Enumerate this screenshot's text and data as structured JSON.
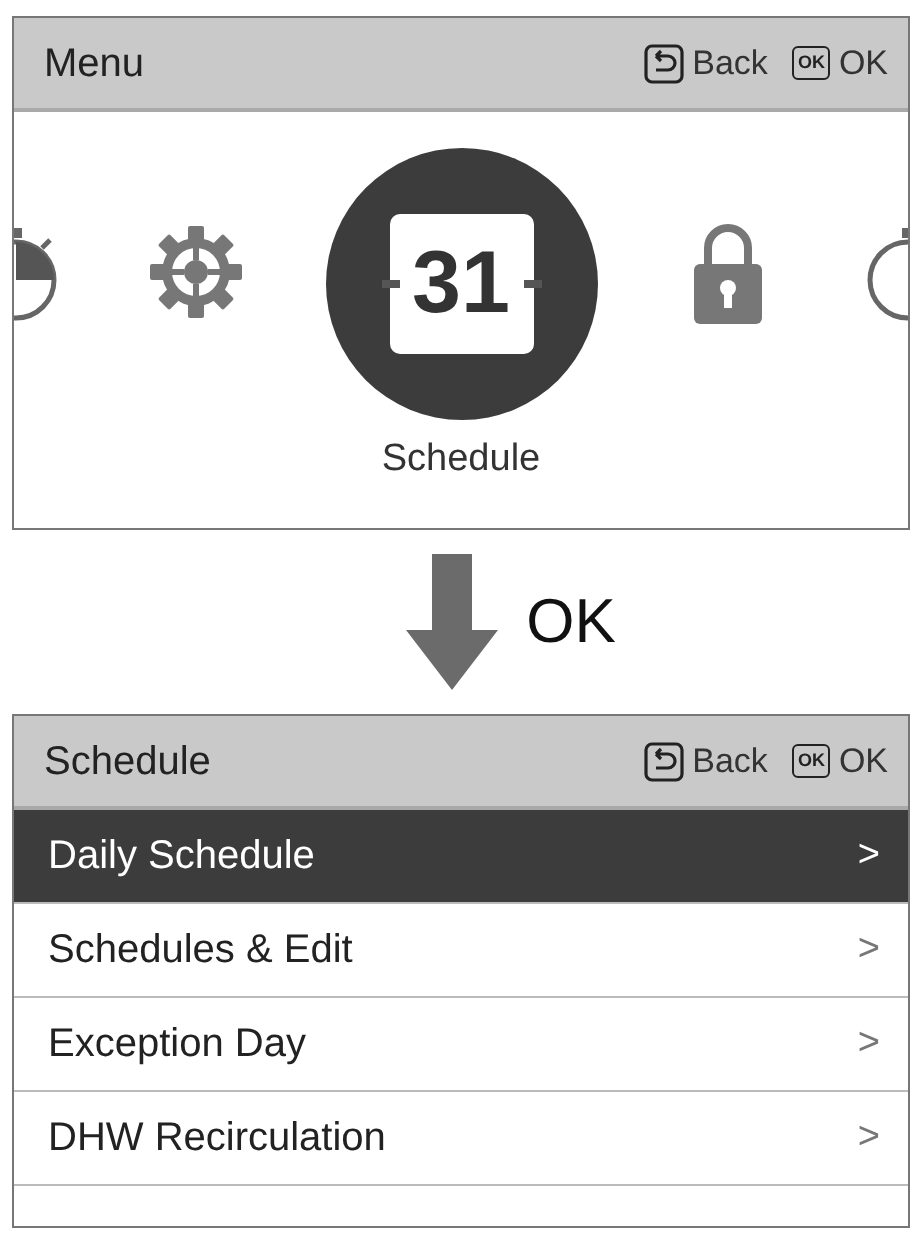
{
  "menu_screen": {
    "header": {
      "title": "Menu",
      "back_label": "Back",
      "ok_key": "OK",
      "ok_label": "OK"
    },
    "carousel": [
      {
        "kind": "timer",
        "selected": false
      },
      {
        "kind": "gear",
        "selected": false
      },
      {
        "kind": "calendar",
        "selected": true,
        "day": "31"
      },
      {
        "kind": "lock",
        "selected": false
      },
      {
        "kind": "timer",
        "selected": false
      }
    ],
    "selected_label": "Schedule"
  },
  "transition": {
    "label": "OK"
  },
  "schedule_screen": {
    "header": {
      "title": "Schedule",
      "back_label": "Back",
      "ok_key": "OK",
      "ok_label": "OK"
    },
    "items": [
      {
        "label": "Daily Schedule",
        "selected": true,
        "chevron": ">"
      },
      {
        "label": "Schedules & Edit",
        "selected": false,
        "chevron": ">"
      },
      {
        "label": "Exception Day",
        "selected": false,
        "chevron": ">"
      },
      {
        "label": "DHW Recirculation",
        "selected": false,
        "chevron": ">"
      }
    ]
  }
}
